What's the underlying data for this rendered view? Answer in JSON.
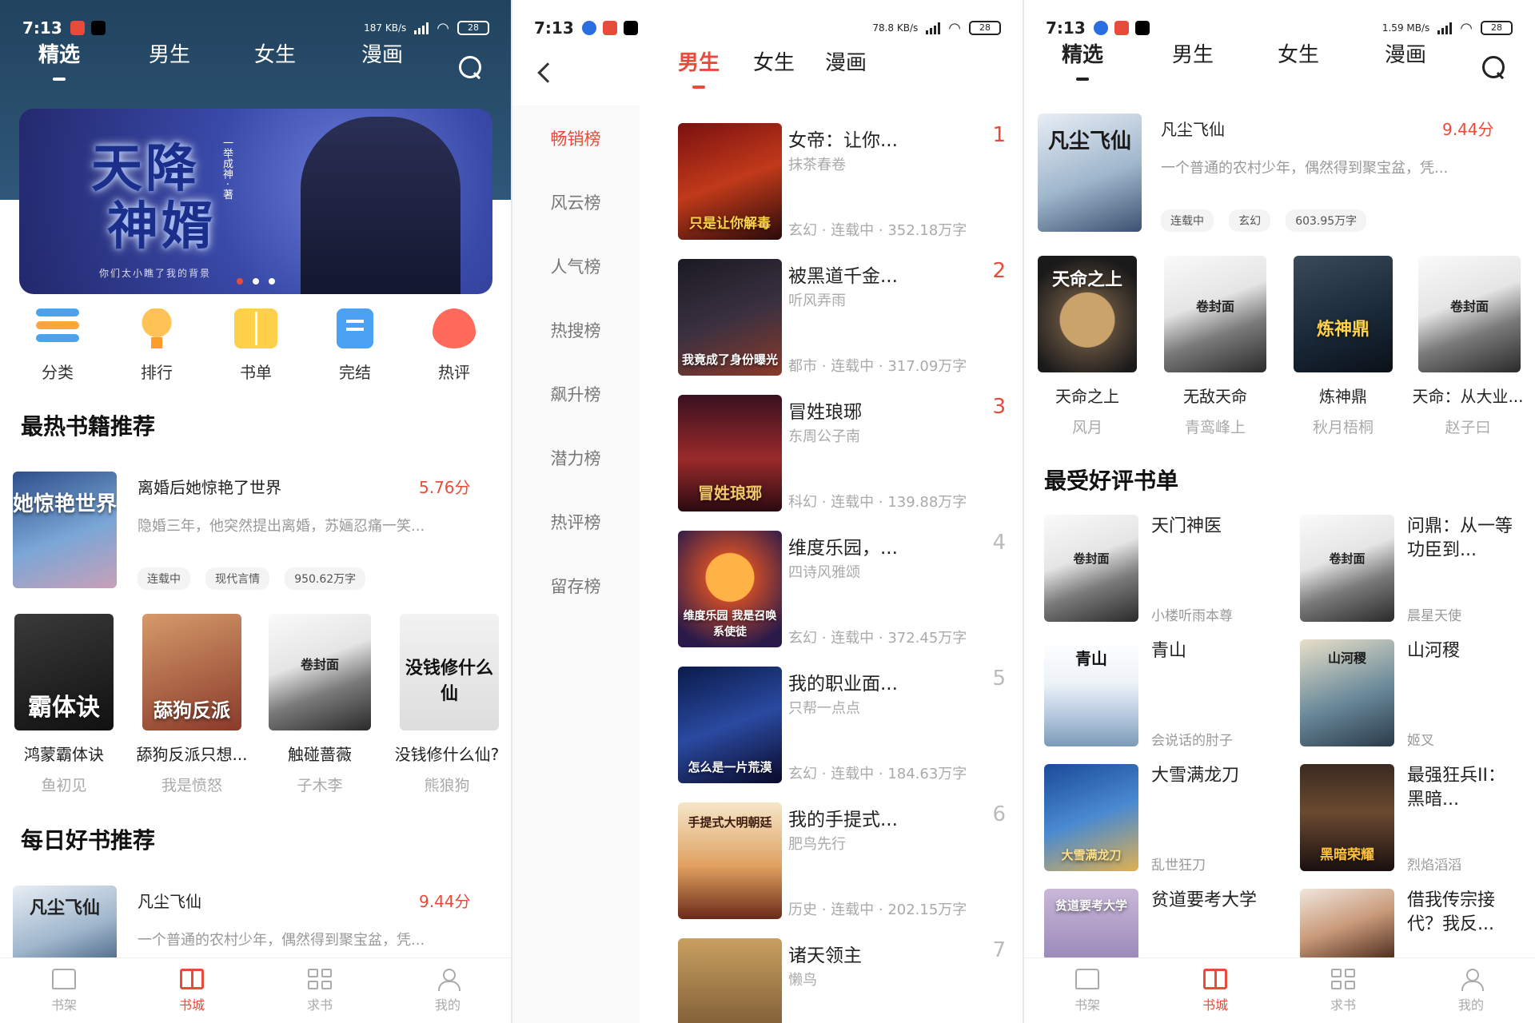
{
  "status": {
    "p1": {
      "time": "7:13",
      "speed": "187 KB/s",
      "battery": "28"
    },
    "p2": {
      "time": "7:13",
      "speed": "78.8 KB/s",
      "battery": "28"
    },
    "p3": {
      "time": "7:13",
      "speed": "1.59 MB/s",
      "battery": "28"
    }
  },
  "colors": {
    "accent": "#e84b3a",
    "header_bg": "#2a4b6b"
  },
  "top_tabs": [
    "精选",
    "男生",
    "女生",
    "漫画"
  ],
  "phone1": {
    "banner": {
      "title_line1": "天降",
      "title_line2": "神婿",
      "side_text": "一举成神 · 著",
      "subtitle": "你们太小瞧了我的背景"
    },
    "quick": [
      {
        "label": "分类",
        "icon": "category-icon"
      },
      {
        "label": "排行",
        "icon": "trophy-icon"
      },
      {
        "label": "书单",
        "icon": "booklist-icon"
      },
      {
        "label": "完结",
        "icon": "finished-icon"
      },
      {
        "label": "热评",
        "icon": "hot-comment-icon"
      }
    ],
    "hot_title": "最热书籍推荐",
    "featured": {
      "cover_text": "她惊艳世界",
      "title": "离婚后她惊艳了世界",
      "score": "5.76分",
      "desc": "隐婚三年，他突然提出离婚，苏婳忍痛一笑...",
      "tags": [
        "连载中",
        "现代言情",
        "950.62万字"
      ]
    },
    "grid": [
      {
        "cover_text": "霸体诀",
        "title": "鸿蒙霸体诀",
        "author": "鱼初见"
      },
      {
        "cover_text": "舔狗反派",
        "title": "舔狗反派只想...",
        "author": "我是愤怒"
      },
      {
        "cover_text": "卷封面",
        "title": "触碰蔷薇",
        "author": "子木李"
      },
      {
        "cover_text": "没钱修什么仙",
        "title": "没钱修什么仙?",
        "author": "熊狼狗"
      }
    ],
    "daily_title": "每日好书推荐",
    "daily": {
      "cover_text": "凡尘飞仙",
      "title": "凡尘飞仙",
      "score": "9.44分",
      "desc": "一个普通的农村少年，偶然得到聚宝盆，凭..."
    }
  },
  "phone2": {
    "tabs": [
      "男生",
      "女生",
      "漫画"
    ],
    "sidebar": [
      "畅销榜",
      "风云榜",
      "人气榜",
      "热搜榜",
      "飙升榜",
      "潜力榜",
      "热评榜",
      "留存榜"
    ],
    "ranks": [
      {
        "num": "1",
        "title": "女帝：让你...",
        "author": "抹茶春卷",
        "meta": "玄幻 · 连载中 · 352.18万字",
        "cover_text": "只是让你解毒"
      },
      {
        "num": "2",
        "title": "被黑道千金...",
        "author": "听风弄雨",
        "meta": "都市 · 连载中 · 317.09万字",
        "cover_text": "我竟成了身份曝光"
      },
      {
        "num": "3",
        "title": "冒姓琅琊",
        "author": "东周公子南",
        "meta": "科幻 · 连载中 · 139.88万字",
        "cover_text": "冒姓琅琊"
      },
      {
        "num": "4",
        "title": "维度乐园，...",
        "author": "四诗风雅颂",
        "meta": "玄幻 · 连载中 · 372.45万字",
        "cover_text": "维度乐园 我是召唤系使徒"
      },
      {
        "num": "5",
        "title": "我的职业面...",
        "author": "只帮一点点",
        "meta": "玄幻 · 连载中 · 184.63万字",
        "cover_text": "怎么是一片荒漠"
      },
      {
        "num": "6",
        "title": "我的手提式...",
        "author": "肥鸟先行",
        "meta": "历史 · 连载中 · 202.15万字",
        "cover_text": "手提式大明朝廷"
      },
      {
        "num": "7",
        "title": "诸天领主",
        "author": "懒鸟",
        "meta": "",
        "cover_text": ""
      }
    ]
  },
  "phone3": {
    "featured": {
      "cover_text": "凡尘飞仙",
      "title": "凡尘飞仙",
      "score": "9.44分",
      "desc": "一个普通的农村少年，偶然得到聚宝盆，凭...",
      "tags": [
        "连载中",
        "玄幻",
        "603.95万字"
      ]
    },
    "row": [
      {
        "cover_text": "天命之上",
        "title": "天命之上",
        "author": "风月"
      },
      {
        "cover_text": "卷封面",
        "title": "无敌天命",
        "author": "青鸾峰上"
      },
      {
        "cover_text": "炼神鼎",
        "title": "炼神鼎",
        "author": "秋月梧桐"
      },
      {
        "cover_text": "卷封面",
        "title": "天命：从大业...",
        "author": "赵子曰"
      }
    ],
    "list_title": "最受好评书单",
    "pairs": [
      {
        "cover_text": "卷封面",
        "title": "天门神医",
        "author": "小楼听雨本尊"
      },
      {
        "cover_text": "卷封面",
        "title": "问鼎：从一等功臣到...",
        "author": "晨星天使"
      },
      {
        "cover_text": "青山",
        "title": "青山",
        "author": "会说话的肘子"
      },
      {
        "cover_text": "山河稷",
        "title": "山河稷",
        "author": "姬叉"
      },
      {
        "cover_text": "大雪满龙刀",
        "title": "大雪满龙刀",
        "author": "乱世狂刀"
      },
      {
        "cover_text": "黑暗荣耀",
        "title": "最强狂兵II：黑暗...",
        "author": "烈焰滔滔"
      },
      {
        "cover_text": "贫道要考大学",
        "title": "贫道要考大学",
        "author": ""
      },
      {
        "cover_text": "",
        "title": "借我传宗接代？我反...",
        "author": ""
      }
    ]
  },
  "bottom_nav": [
    {
      "label": "书架",
      "icon": "bookshelf-icon"
    },
    {
      "label": "书城",
      "icon": "bookstore-icon"
    },
    {
      "label": "求书",
      "icon": "request-book-icon"
    },
    {
      "label": "我的",
      "icon": "profile-icon"
    }
  ]
}
